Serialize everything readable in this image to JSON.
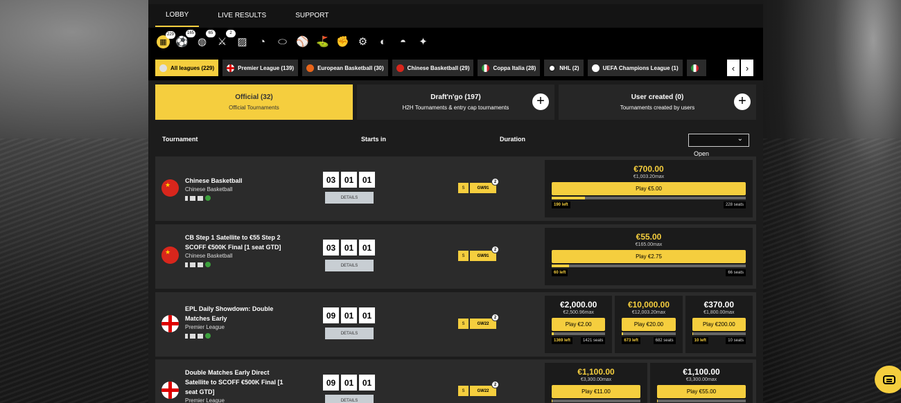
{
  "nav": {
    "tabs": [
      "LOBBY",
      "LIVE RESULTS",
      "SUPPORT"
    ]
  },
  "sports": [
    {
      "icon": "all-sports-icon",
      "glyph": "▦",
      "count": "229"
    },
    {
      "icon": "soccer-ball-icon",
      "glyph": "⚽",
      "count": "165"
    },
    {
      "icon": "basketball-icon",
      "glyph": "◍",
      "count": "65"
    },
    {
      "icon": "ice-hockey-icon",
      "glyph": "⚔",
      "count": "2"
    },
    {
      "icon": "esports-icon",
      "glyph": "▨",
      "count": ""
    },
    {
      "icon": "tennis-ball-icon",
      "glyph": "◔",
      "count": ""
    },
    {
      "icon": "american-football-icon",
      "glyph": "⬭",
      "count": ""
    },
    {
      "icon": "baseball-icon",
      "glyph": "⚾",
      "count": ""
    },
    {
      "icon": "golf-icon",
      "glyph": "⛳",
      "count": ""
    },
    {
      "icon": "boxing-glove-icon",
      "glyph": "✊",
      "count": ""
    },
    {
      "icon": "motorsport-icon",
      "glyph": "⚙",
      "count": ""
    },
    {
      "icon": "cricket-icon",
      "glyph": "◐",
      "count": ""
    },
    {
      "icon": "rugby-helmet-icon",
      "glyph": "◓",
      "count": ""
    },
    {
      "icon": "athletics-icon",
      "glyph": "✦",
      "count": ""
    }
  ],
  "leagues": [
    {
      "label": "All leagues (229)",
      "flag": "ball",
      "active": true
    },
    {
      "label": "Premier League (139)",
      "flag": "eng"
    },
    {
      "label": "European Basketball (30)",
      "flag": "orange"
    },
    {
      "label": "Chinese Basketball (29)",
      "flag": "cn"
    },
    {
      "label": "Coppa Italia (28)",
      "flag": "it"
    },
    {
      "label": "NHL (2)",
      "flag": "nhl"
    },
    {
      "label": "UEFA Champions League (1)",
      "flag": "ucl"
    }
  ],
  "categories": [
    {
      "title": "Official (32)",
      "subtitle": "Official Tournaments",
      "plus": false
    },
    {
      "title": "Draft'n'go (197)",
      "subtitle": "H2H Tournaments & entry cap tournaments",
      "plus": true
    },
    {
      "title": "User created (0)",
      "subtitle": "Tournaments created by users",
      "plus": true
    }
  ],
  "columns": {
    "tournament": "Tournament",
    "starts": "Starts in",
    "duration": "Duration",
    "filter": "Open"
  },
  "details_label": "DETAILS",
  "rows": [
    {
      "name": "Chinese Basketball",
      "league": "Chinese Basketball",
      "flag": "cn",
      "timer": [
        "03",
        "01",
        "01"
      ],
      "gw": "GW91",
      "gw_badge": "2",
      "dur_s": "S",
      "prizes": [
        {
          "amount": "€700.00",
          "gold": true,
          "max": "€1,003.20max",
          "play": "Play €5.00",
          "left": "190 left",
          "seats": "228 seats",
          "fill": 0.17
        }
      ]
    },
    {
      "name": "CB Step 1 Satellite to €55 Step 2 SCOFF €500K Final [1 seat GTD]",
      "league": "Chinese Basketball",
      "flag": "cn",
      "timer": [
        "03",
        "01",
        "01"
      ],
      "gw": "GW91",
      "gw_badge": "2",
      "dur_s": "S",
      "prizes": [
        {
          "amount": "€55.00",
          "gold": true,
          "max": "€165.00max",
          "play": "Play €2.75",
          "left": "60 left",
          "seats": "66 seats",
          "fill": 0.09
        }
      ]
    },
    {
      "name": "EPL Daily Showdown: Double Matches Early",
      "league": "Premier League",
      "flag": "eng",
      "timer": [
        "09",
        "01",
        "01"
      ],
      "gw": "GW22",
      "gw_badge": "2",
      "dur_s": "S",
      "prizes": [
        {
          "amount": "€2,000.00",
          "gold": false,
          "max": "€2,500.96max",
          "play": "Play €2.00",
          "left": "1369 left",
          "seats": "1421 seats",
          "fill": 0.04
        },
        {
          "amount": "€10,000.00",
          "gold": true,
          "max": "€12,003.20max",
          "play": "Play €20.00",
          "left": "673 left",
          "seats": "682 seats",
          "fill": 0.02
        },
        {
          "amount": "€370.00",
          "gold": false,
          "max": "€1,800.00max",
          "play": "Play €200.00",
          "left": "10 left",
          "seats": "10 seats",
          "fill": 0.0
        }
      ]
    },
    {
      "name": "Double Matches Early Direct Satellite to SCOFF €500K Final [1 seat GTD]",
      "league": "Premier League",
      "flag": "eng",
      "timer": [
        "09",
        "01",
        "01"
      ],
      "gw": "GW22",
      "gw_badge": "2",
      "dur_s": "S",
      "prizes": [
        {
          "amount": "€1,100.00",
          "gold": true,
          "max": "€3,300.00max",
          "play": "Play €11.00",
          "left": "",
          "seats": "",
          "fill": 0.0
        },
        {
          "amount": "€1,100.00",
          "gold": false,
          "max": "€3,300.00max",
          "play": "Play €55.00",
          "left": "",
          "seats": "",
          "fill": 0.0
        }
      ]
    }
  ]
}
